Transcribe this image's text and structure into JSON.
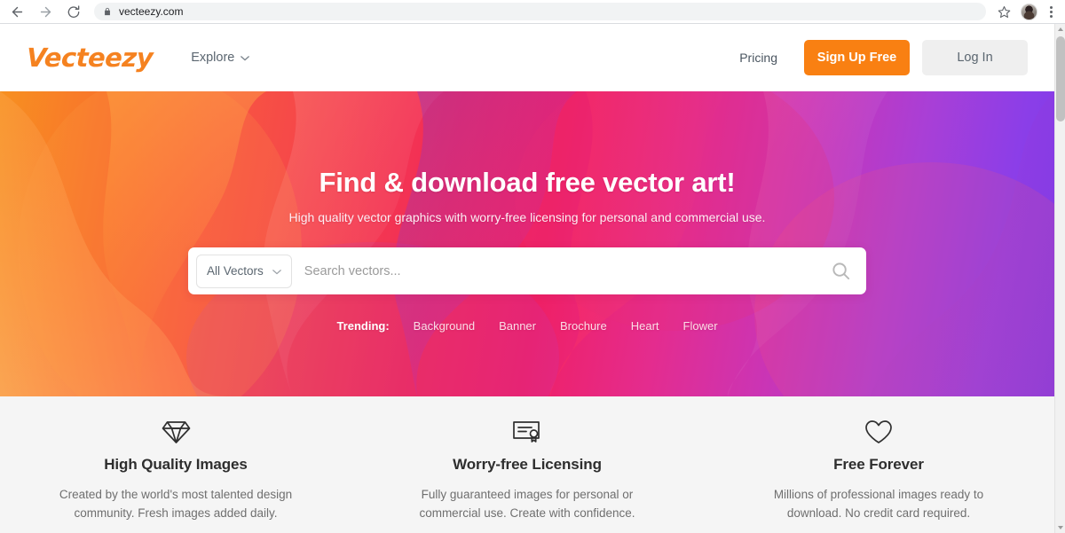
{
  "browser": {
    "url": "vecteezy.com",
    "back_icon": "arrow-left-icon",
    "forward_icon": "arrow-right-icon",
    "reload_icon": "reload-icon",
    "lock_icon": "lock-icon",
    "bookmark_icon": "star-icon",
    "profile_icon": "avatar-icon",
    "menu_icon": "three-dots-icon"
  },
  "site_header": {
    "logo": "Vecteezy",
    "explore_label": "Explore",
    "explore_chevron": "chevron-down-icon",
    "pricing_label": "Pricing",
    "signup_label": "Sign Up Free",
    "login_label": "Log In",
    "signup_color": "#f98012",
    "logo_color": "#f58220"
  },
  "hero": {
    "title": "Find & download free vector art!",
    "subtitle": "High quality vector graphics with worry-free licensing for personal and commercial use.",
    "search": {
      "category_label": "All Vectors",
      "category_chevron": "chevron-down-icon",
      "placeholder": "Search vectors...",
      "value": "",
      "submit_icon": "search-icon"
    },
    "trending": {
      "label": "Trending:",
      "links": [
        "Background",
        "Banner",
        "Brochure",
        "Heart",
        "Flower"
      ]
    },
    "gradient_start": "#f79020",
    "gradient_mid": "#ef2066",
    "gradient_end": "#7b3ae8"
  },
  "features": [
    {
      "icon": "diamond-icon",
      "title": "High Quality Images",
      "desc": "Created by the world's most talented design community. Fresh images added daily."
    },
    {
      "icon": "certificate-icon",
      "title": "Worry-free Licensing",
      "desc": "Fully guaranteed images for personal or commercial use. Create with confidence."
    },
    {
      "icon": "heart-icon",
      "title": "Free Forever",
      "desc": "Millions of professional images ready to download. No credit card required."
    }
  ]
}
